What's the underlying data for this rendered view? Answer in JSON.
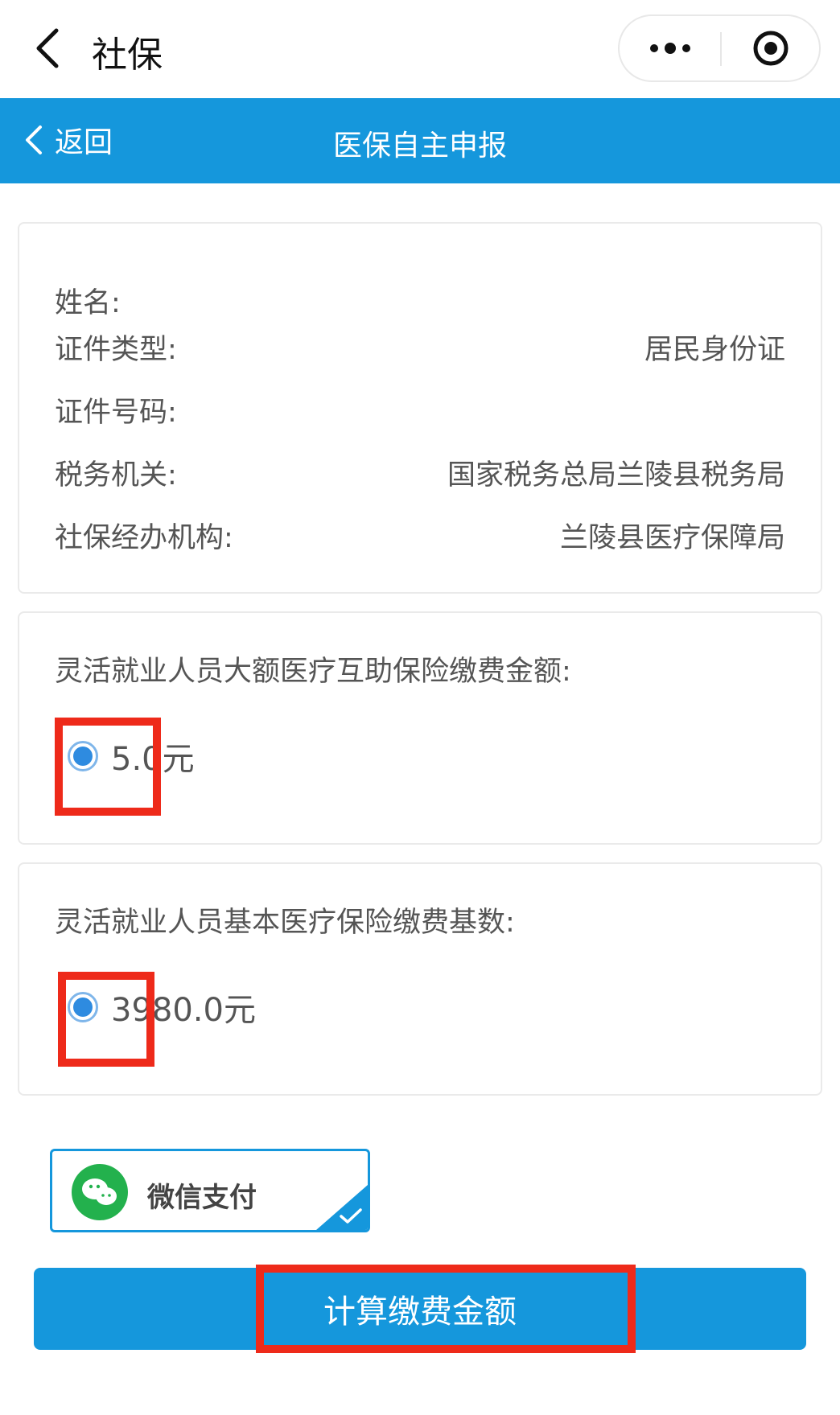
{
  "topbar": {
    "title": "社保"
  },
  "header": {
    "back_label": "返回",
    "title": "医保自主申报"
  },
  "info": {
    "rows": [
      {
        "label": "姓名:",
        "value": ""
      },
      {
        "label": "证件类型:",
        "value": "居民身份证"
      },
      {
        "label": "证件号码:",
        "value": ""
      },
      {
        "label": "税务机关:",
        "value": "国家税务总局兰陵县税务局"
      },
      {
        "label": "社保经办机构:",
        "value": "兰陵县医疗保障局"
      }
    ]
  },
  "amount_section": {
    "title": "灵活就业人员大额医疗互助保险缴费金额:",
    "option": "5.0元",
    "selected": true
  },
  "base_section": {
    "title": "灵活就业人员基本医疗保险缴费基数:",
    "option": "3980.0元",
    "selected": true
  },
  "payment": {
    "label": "微信支付",
    "selected": true
  },
  "actions": {
    "calc_label": "计算缴费金额"
  },
  "colors": {
    "primary": "#1597dc",
    "annotation": "#ee2a1a",
    "wechat_green": "#23b14d"
  }
}
